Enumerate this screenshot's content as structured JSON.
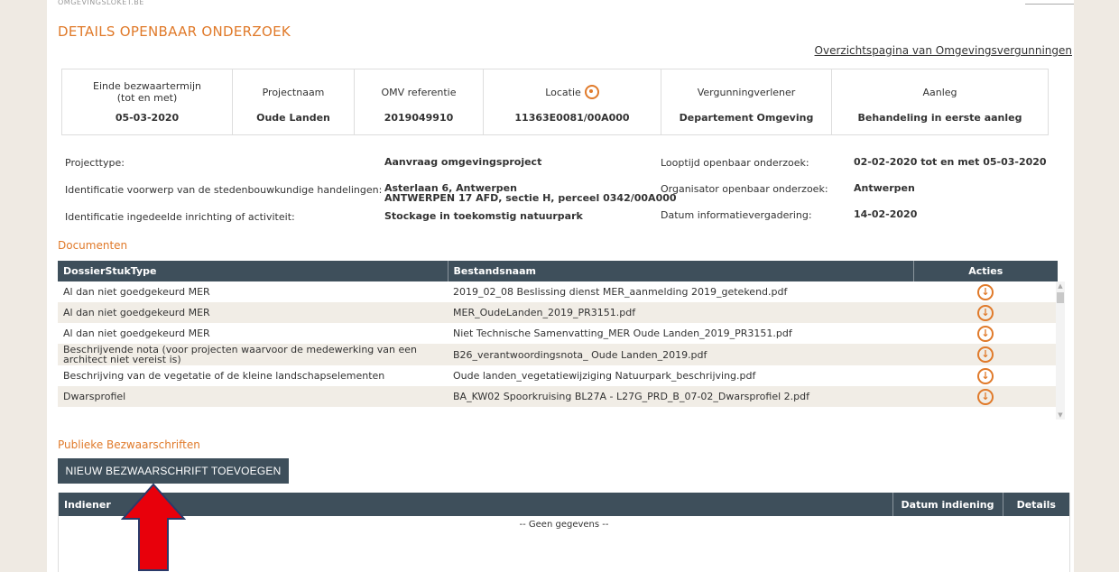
{
  "brand": "OMGEVINGSLOKET.BE",
  "page_title": "DETAILS OPENBAAR ONDERZOEK",
  "overview_link": "Overzichtspagina van Omgevingsvergunningen",
  "info": {
    "cols": [
      {
        "label": "Einde bezwaartermijn\n(tot en met)",
        "value": "05-03-2020"
      },
      {
        "label": "Projectnaam",
        "value": "Oude Landen"
      },
      {
        "label": "OMV referentie",
        "value": "2019049910"
      },
      {
        "label": "Locatie",
        "value": "11363E0081/00A000",
        "icon": "location-pin-icon"
      },
      {
        "label": "Vergunningverlener",
        "value": "Departement Omgeving"
      },
      {
        "label": "Aanleg",
        "value": "Behandeling in eerste aanleg"
      }
    ]
  },
  "details": {
    "projecttype_label": "Projecttype:",
    "projecttype_value": "Aanvraag omgevingsproject",
    "identificatie_voorwerp_label": "Identificatie voorwerp van de stedenbouwkundige handelingen:",
    "identificatie_voorwerp_value_1": "Asterlaan 6, Antwerpen",
    "identificatie_voorwerp_value_2": "ANTWERPEN 17 AFD, sectie H, perceel 0342/00A000",
    "identificatie_inrichting_label": "Identificatie ingedeelde inrichting of activiteit:",
    "identificatie_inrichting_value": "Stockage in toekomstig natuurpark",
    "looptijd_label": "Looptijd openbaar onderzoek:",
    "looptijd_value": "02-02-2020 tot en met 05-03-2020",
    "organisator_label": "Organisator openbaar onderzoek:",
    "organisator_value": "Antwerpen",
    "datum_info_label": "Datum informatievergadering:",
    "datum_info_value": "14-02-2020"
  },
  "documents": {
    "section_title": "Documenten",
    "headers": [
      "DossierStukType",
      "Bestandsnaam",
      "Acties"
    ],
    "rows": [
      {
        "type": "Al dan niet goedgekeurd MER",
        "file": "2019_02_08 Beslissing dienst MER_aanmelding 2019_getekend.pdf"
      },
      {
        "type": "Al dan niet goedgekeurd MER",
        "file": "MER_OudeLanden_2019_PR3151.pdf"
      },
      {
        "type": "Al dan niet goedgekeurd MER",
        "file": "Niet Technische Samenvatting_MER Oude Landen_2019_PR3151.pdf"
      },
      {
        "type": "Beschrijvende nota (voor projecten waarvoor de medewerking van een architect niet vereist is)",
        "file": "B26_verantwoordingsnota_ Oude Landen_2019.pdf"
      },
      {
        "type": "Beschrijving van de vegetatie of de kleine landschapselementen",
        "file": "Oude landen_vegetatiewijziging Natuurpark_beschrijving.pdf"
      },
      {
        "type": "Dwarsprofiel",
        "file": "BA_KW02 Spoorkruising BL27A - L27G_PRD_B_07-02_Dwarsprofiel 2.pdf"
      }
    ]
  },
  "bezwaarschriften": {
    "section_title": "Publieke Bezwaarschriften",
    "add_button": "NIEUW BEZWAARSCHRIFT TOEVOEGEN",
    "headers": [
      "Indiener",
      "Datum indiening",
      "Details"
    ],
    "empty_text": "-- Geen gegevens --"
  },
  "colors": {
    "accent": "#e07a2a",
    "header_bg": "#3e4f5b",
    "annotation_arrow": "#e8000b"
  }
}
